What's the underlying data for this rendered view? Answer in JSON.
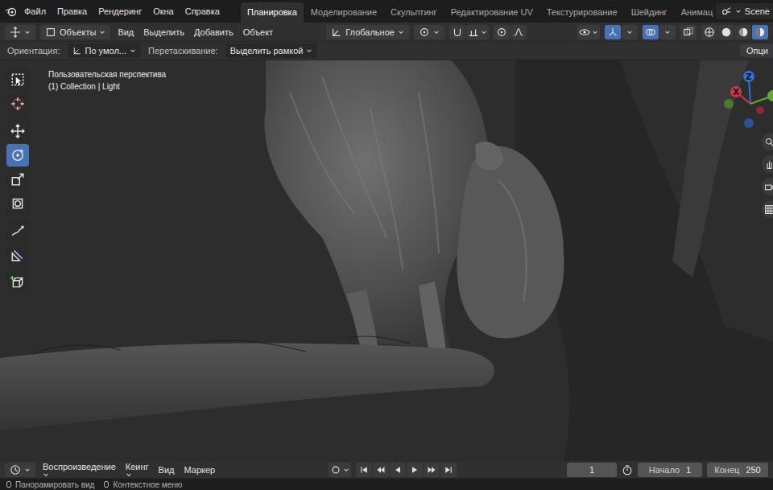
{
  "top_menu": [
    "Файл",
    "Правка",
    "Рендеринг",
    "Окна",
    "Справка"
  ],
  "workspaces": [
    {
      "label": "Планировка",
      "selected": true
    },
    {
      "label": "Моделирование",
      "selected": false
    },
    {
      "label": "Скульптинг",
      "selected": false
    },
    {
      "label": "Редактирование UV",
      "selected": false
    },
    {
      "label": "Текстурирование",
      "selected": false
    },
    {
      "label": "Шейдинг",
      "selected": false
    },
    {
      "label": "Анимац",
      "selected": false
    }
  ],
  "scene": "Scene",
  "header": {
    "mode": "Объекты",
    "menus": [
      "Вид",
      "Выделить",
      "Добавить",
      "Объект"
    ],
    "orientation": "Глобальное",
    "viewport_toggles": [
      {
        "kind": "gizmo",
        "on": true
      },
      {
        "kind": "overlay",
        "on": true
      },
      {
        "kind": "xray",
        "on": false
      }
    ],
    "shading_modes": [
      {
        "kind": "wire",
        "selected": false
      },
      {
        "kind": "solid",
        "selected": false
      },
      {
        "kind": "material",
        "selected": false
      },
      {
        "kind": "rendered",
        "selected": true
      }
    ]
  },
  "tool_settings": {
    "orientation_label": "Ориентация:",
    "orientation_value": "По умол...",
    "drag_label": "Перетаскивание:",
    "drag_value": "Выделить рамкой",
    "options": "Опци"
  },
  "viewport": {
    "view_name": "Пользовательская перспектива",
    "context": "(1) Collection | Light"
  },
  "tools": [
    {
      "kind": "select",
      "selected": false
    },
    {
      "kind": "cursor",
      "selected": false
    },
    {
      "kind": "move",
      "selected": false
    },
    {
      "kind": "rotate",
      "selected": true
    },
    {
      "kind": "scale",
      "selected": false
    },
    {
      "kind": "transform",
      "selected": false
    },
    {
      "kind": "annotate",
      "selected": false
    },
    {
      "kind": "measure",
      "selected": false
    },
    {
      "kind": "add",
      "selected": false
    }
  ],
  "gizmo": [
    {
      "label": "Z",
      "color": "#2f6fd6"
    },
    {
      "label": "X",
      "color": "#d0344a"
    }
  ],
  "timeline": {
    "menus": [
      "Воспроизведение",
      "Кеинг",
      "Вид",
      "Маркер"
    ],
    "current_frame": "1",
    "start_label": "Начало",
    "start": "1",
    "end_label": "Конец",
    "end": "250"
  },
  "status_bar": [
    "Панорамировать вид",
    "Контекстное меню"
  ]
}
